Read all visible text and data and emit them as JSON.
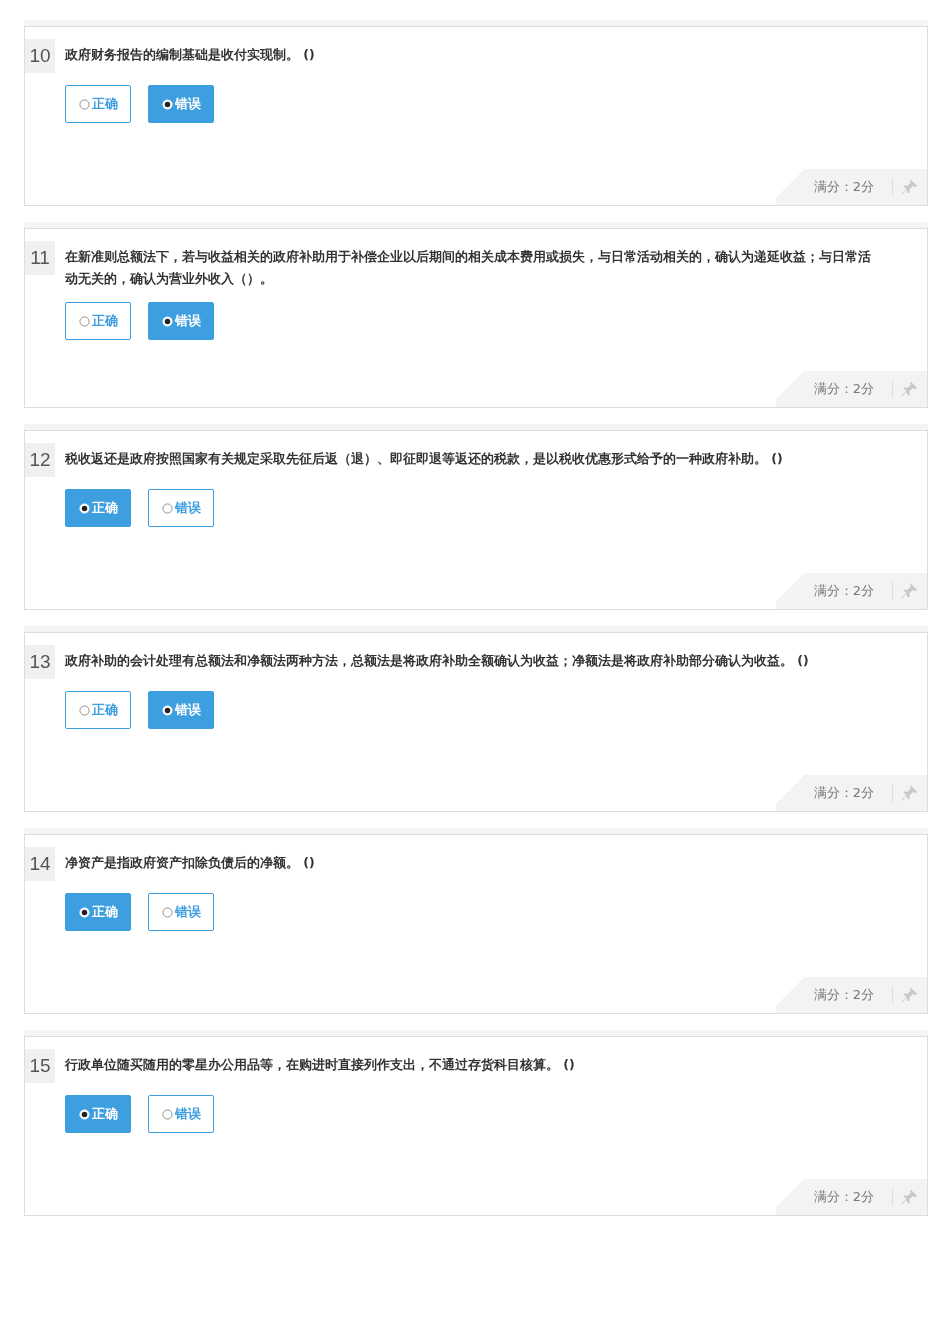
{
  "questions": [
    {
      "number": "10",
      "text": "政府财务报告的编制基础是收付实现制。 ()",
      "options": [
        {
          "label": "正确",
          "selected": false
        },
        {
          "label": "错误",
          "selected": true
        }
      ],
      "score": "满分：2分"
    },
    {
      "number": "11",
      "text": "在新准则总额法下，若与收益相关的政府补助用于补偿企业以后期间的相关成本费用或损失，与日常活动相关的，确认为递延收益；与日常活动无关的，确认为营业外收入（）。",
      "options": [
        {
          "label": "正确",
          "selected": false
        },
        {
          "label": "错误",
          "selected": true
        }
      ],
      "score": "满分：2分"
    },
    {
      "number": "12",
      "text": "税收返还是政府按照国家有关规定采取先征后返（退）、即征即退等返还的税款，是以税收优惠形式给予的一种政府补助。 ()",
      "options": [
        {
          "label": "正确",
          "selected": true
        },
        {
          "label": "错误",
          "selected": false
        }
      ],
      "score": "满分：2分"
    },
    {
      "number": "13",
      "text": "政府补助的会计处理有总额法和净额法两种方法，总额法是将政府补助全额确认为收益；净额法是将政府补助部分确认为收益。 ()",
      "options": [
        {
          "label": "正确",
          "selected": false
        },
        {
          "label": "错误",
          "selected": true
        }
      ],
      "score": "满分：2分"
    },
    {
      "number": "14",
      "text": "净资产是指政府资产扣除负债后的净额。 ()",
      "options": [
        {
          "label": "正确",
          "selected": true
        },
        {
          "label": "错误",
          "selected": false
        }
      ],
      "score": "满分：2分"
    },
    {
      "number": "15",
      "text": "行政单位随买随用的零星办公用品等，在购进时直接列作支出，不通过存货科目核算。 ()",
      "options": [
        {
          "label": "正确",
          "selected": true
        },
        {
          "label": "错误",
          "selected": false
        }
      ],
      "score": "满分：2分"
    }
  ]
}
